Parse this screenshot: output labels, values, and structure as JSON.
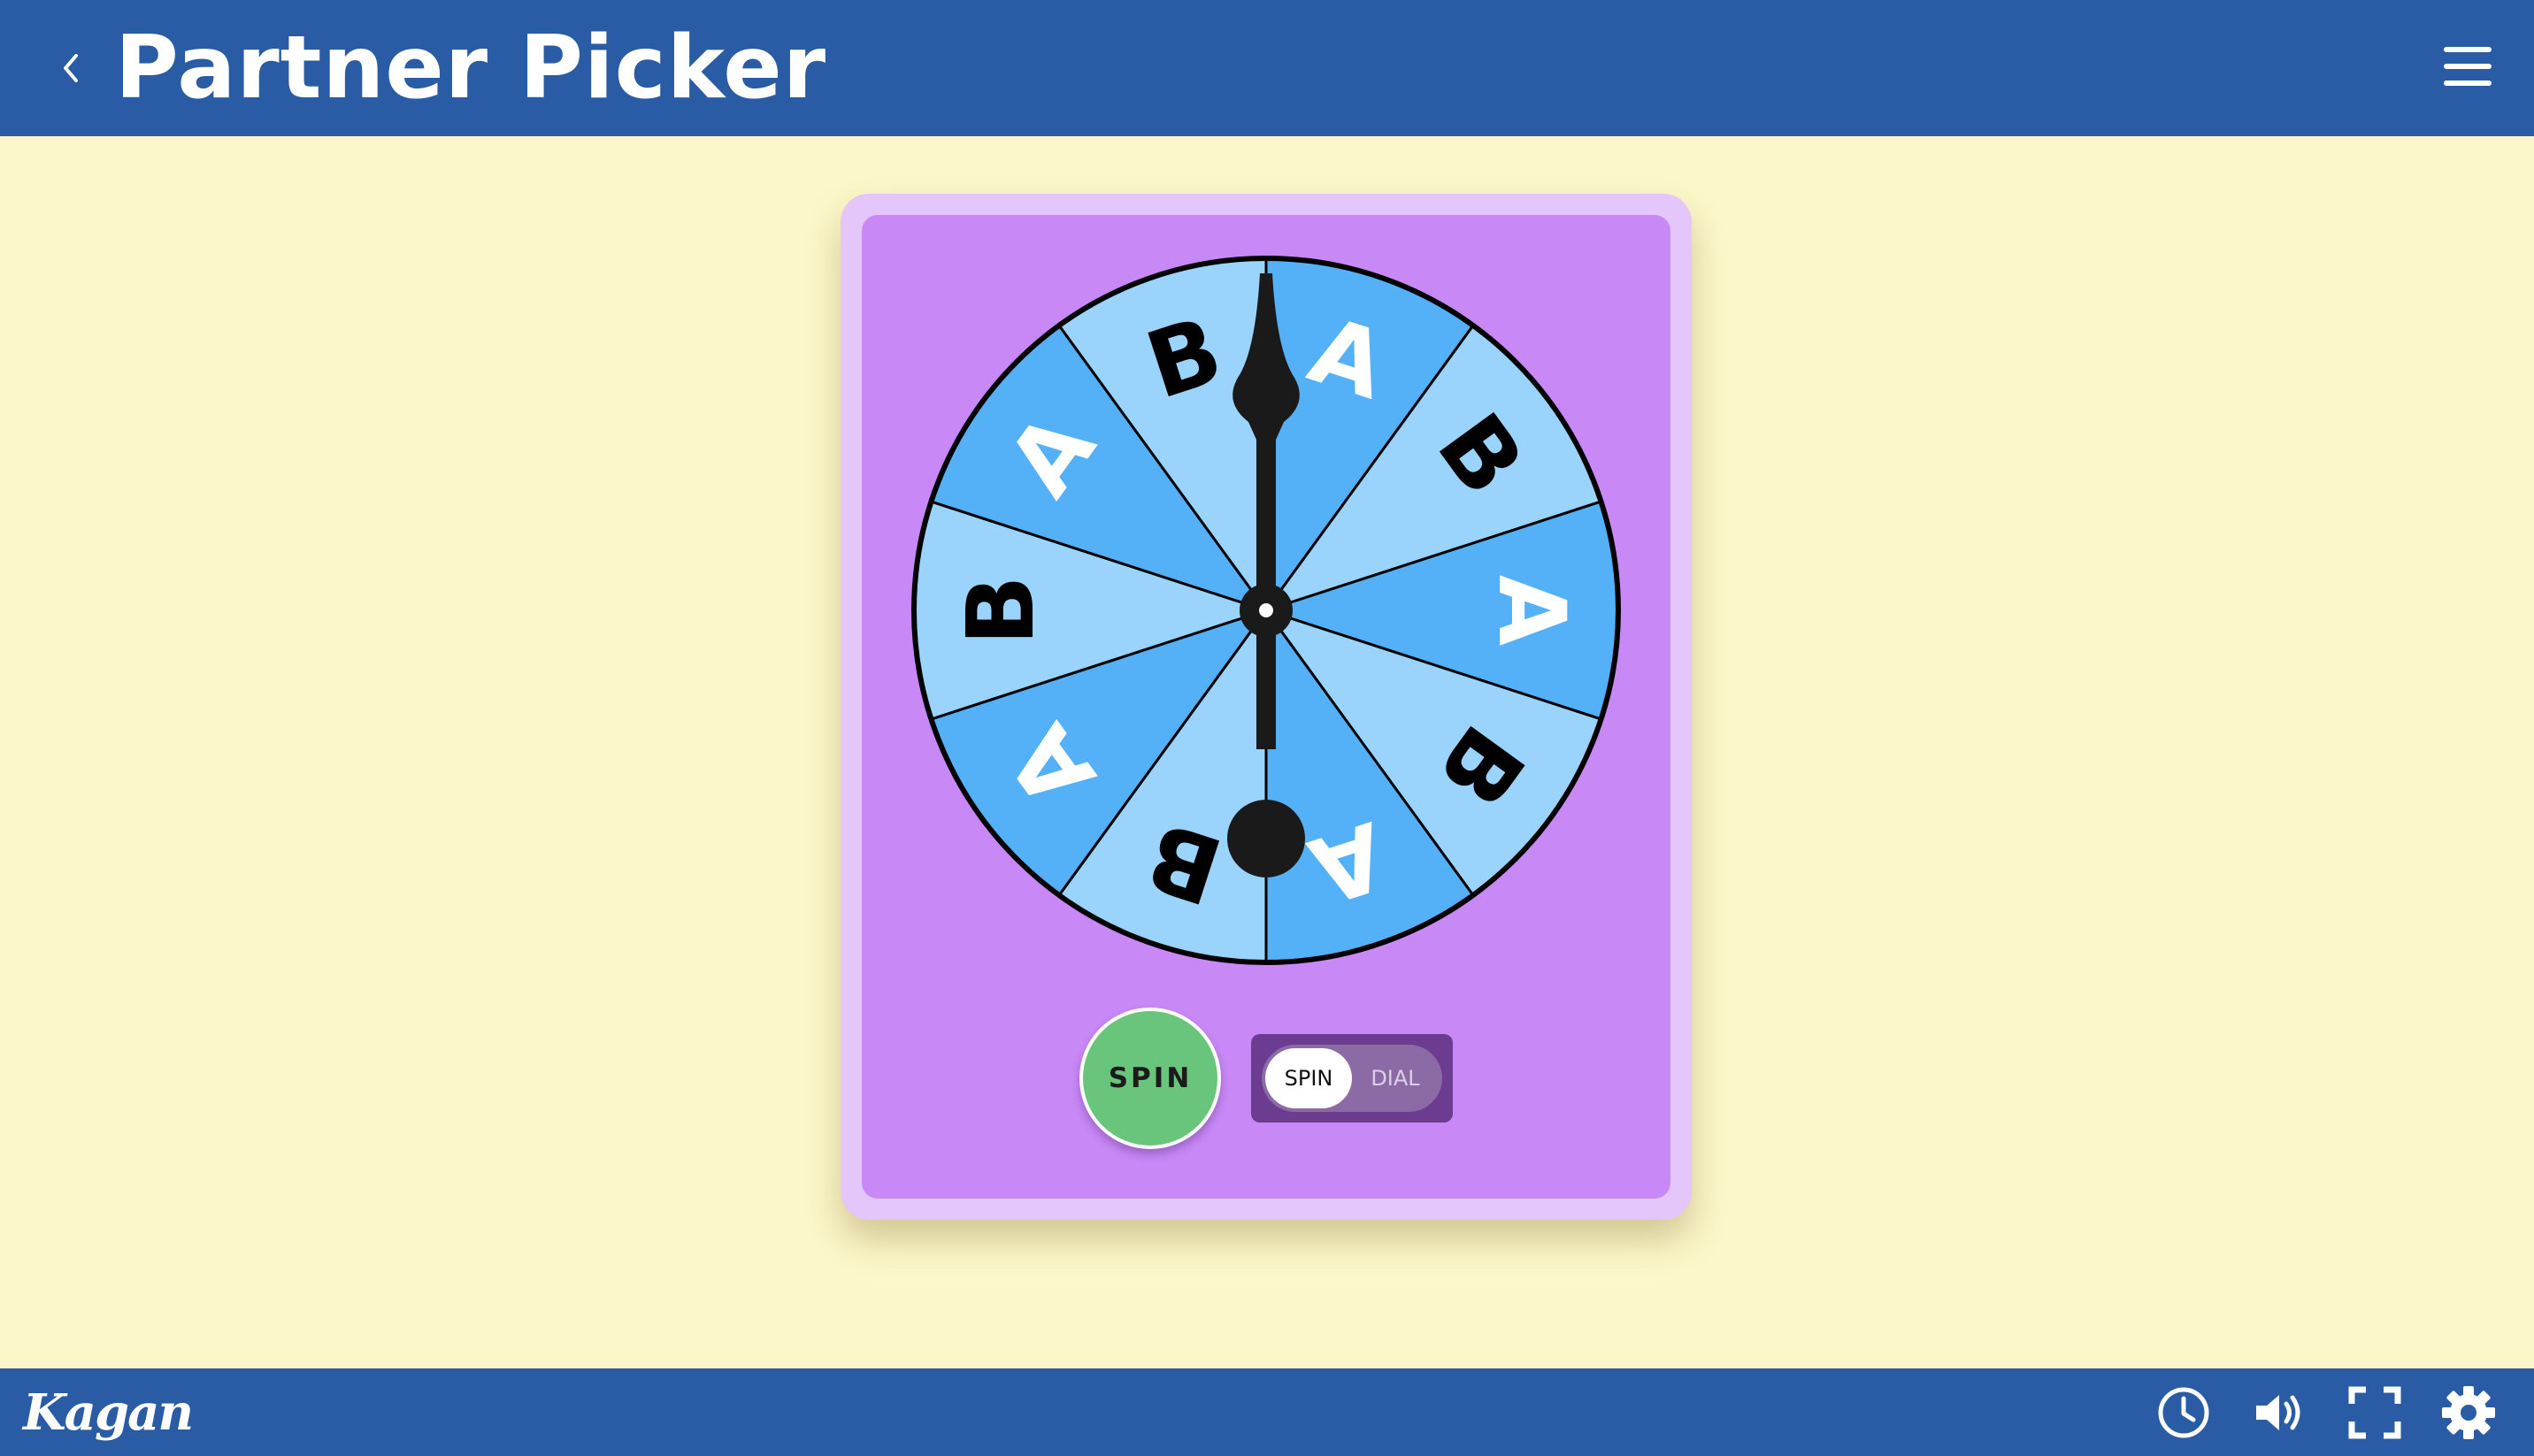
{
  "header": {
    "title": "Partner Picker",
    "back_icon": "chevron-left-icon",
    "menu_icon": "hamburger-menu-icon"
  },
  "spinner": {
    "segment_labels": [
      "A",
      "B",
      "A",
      "B",
      "A",
      "B",
      "A",
      "B",
      "A",
      "B"
    ],
    "segment_colors": [
      "#54b1f8",
      "#9ad4fc"
    ],
    "label_colors": {
      "A": "#ffffff",
      "B": "#000000"
    },
    "pointer_direction": "up"
  },
  "controls": {
    "spin_button_label": "SPIN",
    "mode_options": [
      "SPIN",
      "DIAL"
    ],
    "selected_mode": "SPIN"
  },
  "footer": {
    "logo_text": "Kagan",
    "icons": [
      "clock-icon",
      "volume-icon",
      "fullscreen-icon",
      "gear-icon"
    ]
  },
  "colors": {
    "bar": "#2a5ba5",
    "background": "#fcf7c8",
    "card": "#c889f7",
    "spin_button": "#68c57b"
  }
}
